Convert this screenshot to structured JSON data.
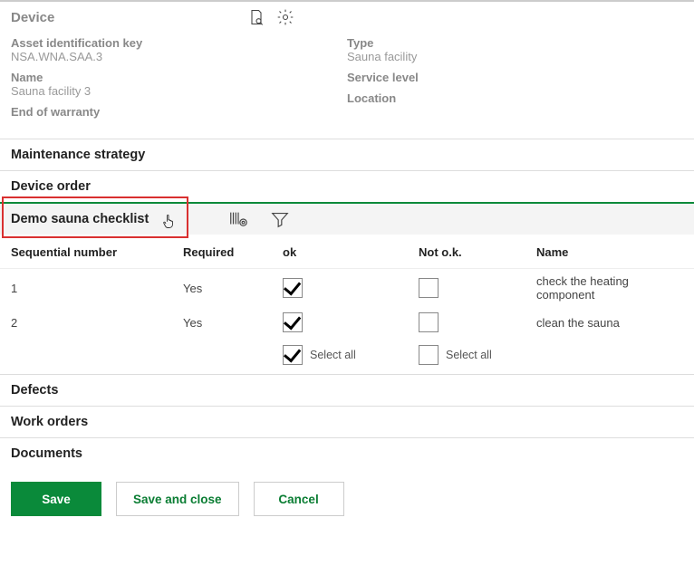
{
  "device": {
    "section_title": "Device",
    "fields": {
      "asset_id_label": "Asset identification key",
      "asset_id_value": "NSA.WNA.SAA.3",
      "name_label": "Name",
      "name_value": "Sauna facility 3",
      "eow_label": "End of warranty",
      "eow_value": "",
      "type_label": "Type",
      "type_value": "Sauna facility",
      "service_label": "Service level",
      "service_value": "",
      "location_label": "Location",
      "location_value": ""
    }
  },
  "sections": {
    "maintenance": "Maintenance strategy",
    "device_order": "Device order",
    "checklist": "Demo sauna checklist",
    "defects": "Defects",
    "work_orders": "Work orders",
    "documents": "Documents"
  },
  "table": {
    "headers": {
      "seq": "Sequential number",
      "required": "Required",
      "ok": "ok",
      "notok": "Not o.k.",
      "name": "Name"
    },
    "rows": [
      {
        "seq": "1",
        "required": "Yes",
        "ok": true,
        "notok": false,
        "name": "check the heating component"
      },
      {
        "seq": "2",
        "required": "Yes",
        "ok": true,
        "notok": false,
        "name": "clean the sauna"
      }
    ],
    "select_all": "Select all",
    "select_all_ok": true,
    "select_all_notok": false
  },
  "buttons": {
    "save": "Save",
    "save_close": "Save and close",
    "cancel": "Cancel"
  }
}
